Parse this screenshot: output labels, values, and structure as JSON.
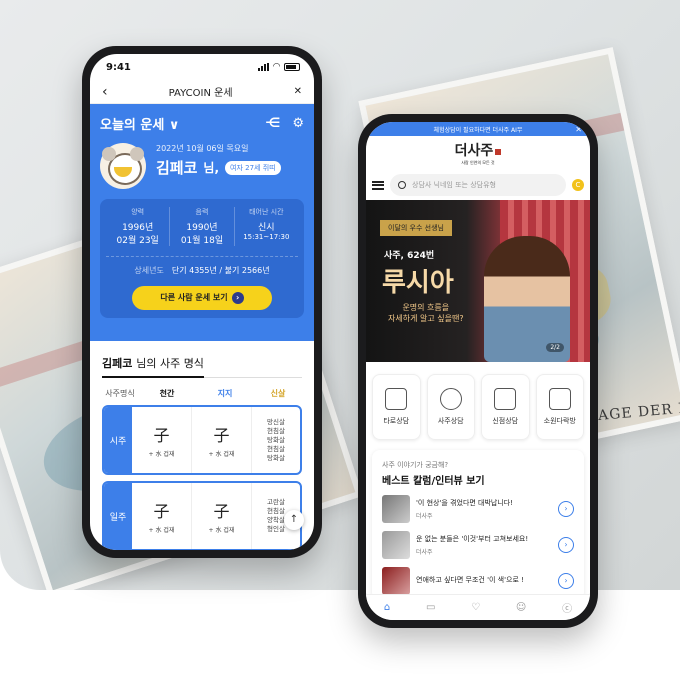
{
  "left_phone": {
    "status": {
      "time": "9:41"
    },
    "nav": {
      "back": "‹",
      "title": "PAYCOIN 운세",
      "close": "✕"
    },
    "header": {
      "title": "오늘의 운세 ∨",
      "share_icon": "share-icon",
      "gear_icon": "gear-icon"
    },
    "profile": {
      "date": "2022년 10월 06일 목요일",
      "name": "김페코",
      "suffix": "님,",
      "age_badge": "여자 27세 쥐띠",
      "solar_label": "양력",
      "solar_year": "1996년",
      "solar_date": "02월 23일",
      "lunar_label": "음력",
      "lunar_year": "1990년",
      "lunar_date": "01월 18일",
      "birth_label": "태어난 시간",
      "birth_hour": "신시",
      "birth_range": "15:31~17:30",
      "detail_label": "상세년도",
      "detail_value": "단기 4355년 / 불기 2566년",
      "cta": "다른 사람 운세 보기"
    },
    "saju": {
      "title_name": "김페코",
      "title_rest": "님의 사주 명식",
      "col_label": "사주명식",
      "col_cheongan": "천간",
      "col_jiji": "지지",
      "col_sinsal": "신살",
      "rows": [
        {
          "label": "시주",
          "char1": "子",
          "sub1": "+ 水 겁재",
          "char2": "子",
          "sub2": "+ 水 겁재",
          "sal": [
            "망신살",
            "현침살",
            "탕화살",
            "현침살",
            "탕화살"
          ]
        },
        {
          "label": "일주",
          "char1": "子",
          "sub1": "+ 水 겁재",
          "char2": "子",
          "sub2": "+ 水 겁재",
          "sal": [
            "고란살",
            "현침살",
            "양착살",
            "형인살"
          ]
        }
      ]
    }
  },
  "right_phone": {
    "banner": "체험상담이 필요하다면 더사주 AI무",
    "logo": {
      "name": "더사주",
      "tagline": "사람 인연의 모든 것"
    },
    "search": {
      "placeholder": "상담사 닉네임 또는 상담유형"
    },
    "hero": {
      "tag": "이달의 우수 선생님",
      "subtitle": "사주, 624번",
      "name": "루시아",
      "desc1": "운명의 흐름을",
      "desc2": "자세하게 알고 싶을땐?",
      "page": "2/2"
    },
    "categories": [
      {
        "label": "타로상담"
      },
      {
        "label": "사주상담"
      },
      {
        "label": "신점상담"
      },
      {
        "label": "소원다락방"
      }
    ],
    "best": {
      "question": "사주 이야기가 궁금해?",
      "title": "베스트 칼럼/인터뷰 보기",
      "items": [
        {
          "title": "'이 현상'을 겪었다면 대박납니다!",
          "author": "더사주"
        },
        {
          "title": "운 없는 분들은 '이것'부터 고쳐보세요!",
          "author": "더사주"
        },
        {
          "title": "연애하고 싶다면 무조건 '이 색'으로 !",
          "author": ""
        }
      ]
    }
  },
  "background": {
    "caption": "AGE DER K"
  },
  "colors": {
    "primary": "#3d7fe9",
    "cta": "#f6d21b",
    "accent_red": "#b63d44"
  }
}
